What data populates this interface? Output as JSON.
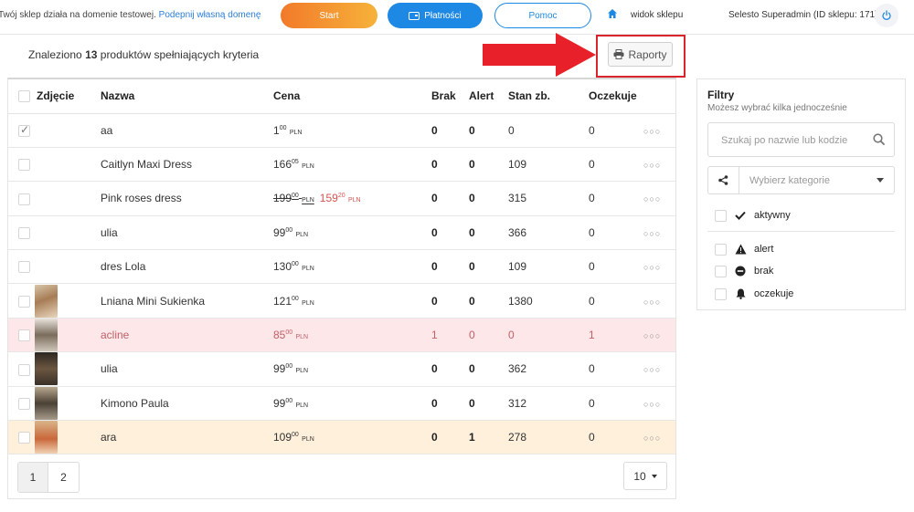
{
  "topbar": {
    "notice_text": "Twój sklep działa na domenie testowej.",
    "notice_link": "Podepnij własną domenę",
    "start_label": "Start",
    "payments_label": "Płatności",
    "help_label": "Pomoc",
    "shop_view_label": "widok sklepu",
    "user_label": "Selesto Superadmin (ID sklepu: 171)"
  },
  "summary": {
    "prefix": "Znaleziono",
    "count": "13",
    "suffix": "produktów spełniających kryteria"
  },
  "reports_label": "Raporty",
  "table": {
    "columns": {
      "photo": "Zdjęcie",
      "name": "Nazwa",
      "price": "Cena",
      "brak": "Brak",
      "alert": "Alert",
      "stan": "Stan zb.",
      "oczekuje": "Oczekuje"
    },
    "currency": "PLN",
    "rows": [
      {
        "name": "aa",
        "price_main": "1",
        "price_cents": "00",
        "old_main": "",
        "old_cents": "",
        "brak": "0",
        "alert": "0",
        "stan": "0",
        "oczekuje": "0"
      },
      {
        "name": "Caitlyn Maxi Dress",
        "price_main": "166",
        "price_cents": "05",
        "old_main": "",
        "old_cents": "",
        "brak": "0",
        "alert": "0",
        "stan": "109",
        "oczekuje": "0"
      },
      {
        "name": "Pink roses dress",
        "price_main": "159",
        "price_cents": "20",
        "old_main": "199",
        "old_cents": "00",
        "brak": "0",
        "alert": "0",
        "stan": "315",
        "oczekuje": "0"
      },
      {
        "name": "ulia",
        "price_main": "99",
        "price_cents": "00",
        "old_main": "",
        "old_cents": "",
        "brak": "0",
        "alert": "0",
        "stan": "366",
        "oczekuje": "0"
      },
      {
        "name": "dres Lola",
        "price_main": "130",
        "price_cents": "00",
        "old_main": "",
        "old_cents": "",
        "brak": "0",
        "alert": "0",
        "stan": "109",
        "oczekuje": "0"
      },
      {
        "name": "Lniana Mini Sukienka",
        "price_main": "121",
        "price_cents": "00",
        "old_main": "",
        "old_cents": "",
        "brak": "0",
        "alert": "0",
        "stan": "1380",
        "oczekuje": "0"
      },
      {
        "name": "acline",
        "price_main": "85",
        "price_cents": "00",
        "old_main": "",
        "old_cents": "",
        "brak": "1",
        "alert": "0",
        "stan": "0",
        "oczekuje": "1"
      },
      {
        "name": "ulia",
        "price_main": "99",
        "price_cents": "00",
        "old_main": "",
        "old_cents": "",
        "brak": "0",
        "alert": "0",
        "stan": "362",
        "oczekuje": "0"
      },
      {
        "name": "Kimono Paula",
        "price_main": "99",
        "price_cents": "00",
        "old_main": "",
        "old_cents": "",
        "brak": "0",
        "alert": "0",
        "stan": "312",
        "oczekuje": "0"
      },
      {
        "name": "ara",
        "price_main": "109",
        "price_cents": "00",
        "old_main": "",
        "old_cents": "",
        "brak": "0",
        "alert": "1",
        "stan": "278",
        "oczekuje": "0"
      }
    ]
  },
  "pagination": {
    "pages": [
      "1",
      "2"
    ],
    "per_page": "10"
  },
  "filters": {
    "title": "Filtry",
    "subtitle": "Możesz wybrać kilka jednocześnie",
    "search_placeholder": "Szukaj po nazwie lub kodzie",
    "category_placeholder": "Wybierz kategorie",
    "active_label": "aktywny",
    "alert_label": "alert",
    "brak_label": "brak",
    "oczekuje_label": "oczekuje"
  },
  "colors": {
    "accent": "#1e88e5",
    "start_gradient": "#f27a2a",
    "danger_row": "#fde7e8",
    "warning_row": "#fff0dc",
    "highlight": "#d9232d"
  }
}
